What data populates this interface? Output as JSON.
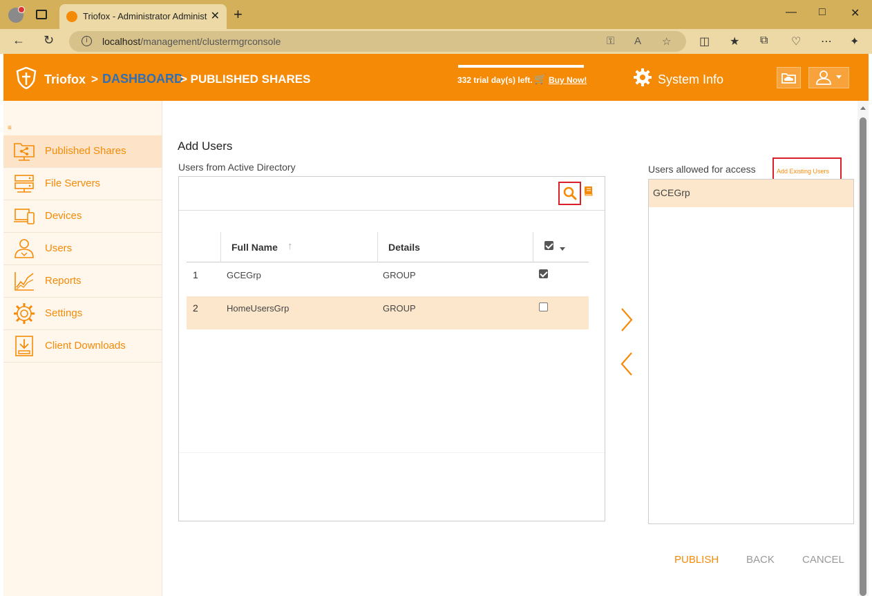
{
  "browser": {
    "tab_title": "Triofox - Administrator Administra",
    "url_host": "localhost",
    "url_path": "/management/clustermgrconsole",
    "new_tab_label": "+",
    "tab_close": "✕"
  },
  "header": {
    "brand": "Triofox",
    "crumb_sep_1": ">",
    "crumb_dashboard": "DASHBOARD",
    "crumb_current": "> PUBLISHED SHARES",
    "trial_text": "332 trial day(s) left.",
    "buy_now": "Buy Now!",
    "system_info": "System Info",
    "colors": {
      "bar": "#f58a07",
      "link": "#2f6fb5"
    }
  },
  "sidebar": {
    "items": [
      {
        "label": "Published Shares",
        "icon": "share-folder-icon",
        "active": true
      },
      {
        "label": "File Servers",
        "icon": "server-icon",
        "active": false
      },
      {
        "label": "Devices",
        "icon": "devices-icon",
        "active": false
      },
      {
        "label": "Users",
        "icon": "users-icon",
        "active": false
      },
      {
        "label": "Reports",
        "icon": "chart-icon",
        "active": false
      },
      {
        "label": "Settings",
        "icon": "gear-icon",
        "active": false
      },
      {
        "label": "Client Downloads",
        "icon": "download-icon",
        "active": false
      }
    ]
  },
  "main": {
    "title": "Add Users",
    "ad_label": "Users from Active Directory",
    "search_value": "",
    "columns": {
      "full_name": "Full Name",
      "details": "Details"
    },
    "rows": [
      {
        "num": "1",
        "name": "GCEGrp",
        "details": "GROUP",
        "checked": true
      },
      {
        "num": "2",
        "name": "HomeUsersGrp",
        "details": "GROUP",
        "checked": false
      }
    ],
    "allowed_label": "Users allowed for access",
    "add_existing": "Add Existing Users",
    "allowed_users": [
      "GCEGrp"
    ],
    "actions": {
      "publish": "PUBLISH",
      "back": "BACK",
      "cancel": "CANCEL"
    }
  }
}
